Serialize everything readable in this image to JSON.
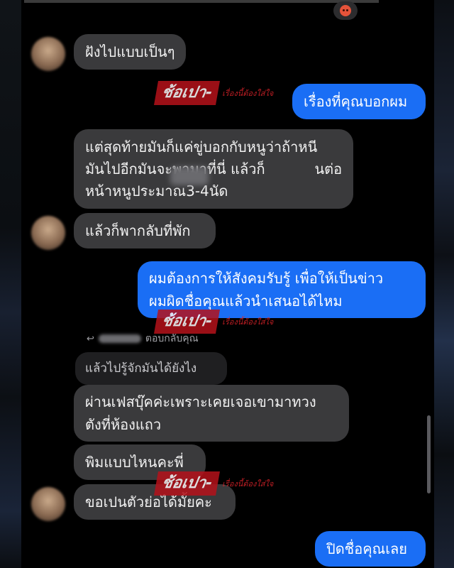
{
  "reaction": {
    "icon": "angry-face-icon"
  },
  "messages": [
    {
      "id": "m1",
      "side": "incoming",
      "text": "ฝังไปแบบเป็นๆ"
    },
    {
      "id": "m2",
      "side": "outgoing",
      "text": "เรื่องที่คุณบอกผม"
    },
    {
      "id": "m3",
      "side": "incoming",
      "text": "แต่สุดท้ายมันก็แค่ขู่บอกกับหนูว่าถ้าหนี\nมันไปอีกมันจะพามาที่นี่ แล้วก็           นต่อ\nหน้าหนูประมาณ3-4นัด"
    },
    {
      "id": "m4",
      "side": "incoming",
      "text": "แล้วก็พากลับที่พัก"
    },
    {
      "id": "m5",
      "side": "outgoing",
      "text": "ผมต้องการให้สังคมรับรู้ เพื่อให้เป็นข่าว\nผมผิดชื่อคุณแล้วนำเสนอได้ไหม"
    },
    {
      "id": "m7",
      "side": "incoming",
      "text": "ผ่านเฟสบุ๊คค่ะเพราะเคยเจอเขามาทวง\nตังที่ห้องแถว"
    },
    {
      "id": "m8",
      "side": "incoming",
      "text": "พิมแบบไหนคะพี่"
    },
    {
      "id": "m9",
      "side": "incoming",
      "text": "ขอเปนตัวย่อได้มั้ยคะ"
    },
    {
      "id": "m10",
      "side": "outgoing",
      "text": "ปิดชื่อคุณเลย"
    }
  ],
  "reply": {
    "label": "ตอบกลับคุณ",
    "quoted_text": "แล้วไปรู้จักมันได้ยังไง"
  },
  "watermark": {
    "main": "ช้อเปา-",
    "sub": "เรื่องนี้ต้องใส่ใจ"
  },
  "colors": {
    "incoming_bubble": "#3a3a3c",
    "outgoing_bubble": "#1a6ef5",
    "background": "#000000",
    "watermark_red": "#b5121b"
  }
}
